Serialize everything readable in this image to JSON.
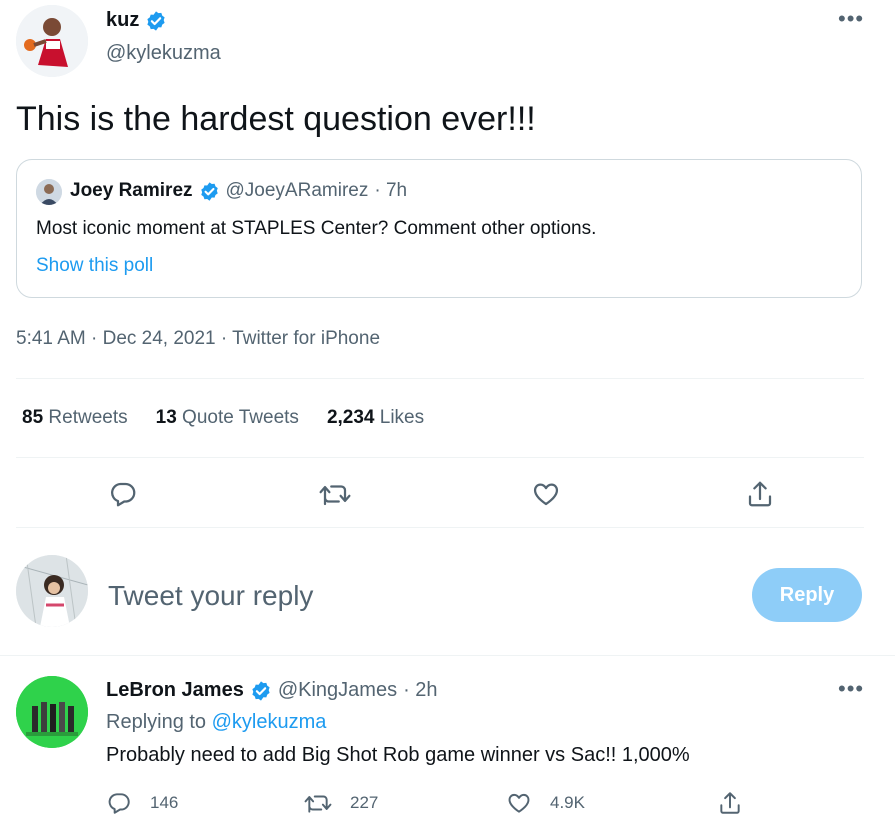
{
  "tweet": {
    "author_name": "kuz",
    "author_handle": "@kylekuzma",
    "text": "This is the hardest question ever!!!",
    "more_label": "•••",
    "timestamp": "5:41 AM · Dec 24, 2021 · Twitter for iPhone",
    "stats": {
      "retweets_count": "85",
      "retweets_label": "Retweets",
      "quotes_count": "13",
      "quotes_label": "Quote Tweets",
      "likes_count": "2,234",
      "likes_label": "Likes"
    }
  },
  "quoted": {
    "author_name": "Joey Ramirez",
    "author_handle": "@JoeyARamirez",
    "age": "· 7h",
    "text": "Most iconic moment at STAPLES Center? Comment other options.",
    "poll_link": "Show this poll"
  },
  "reply_box": {
    "placeholder": "Tweet your reply",
    "button_label": "Reply"
  },
  "reply": {
    "author_name": "LeBron James",
    "author_handle": "@KingJames",
    "age": "· 2h",
    "replying_prefix": "Replying to",
    "replying_to": "@kylekuzma",
    "text": "Probably need to add Big Shot Rob game winner vs Sac!! 1,000%",
    "more_label": "•••",
    "reply_count": "146",
    "retweet_count": "227",
    "like_count": "4.9K"
  },
  "colors": {
    "accent": "#1d9bf0",
    "muted": "#536471",
    "reply_button_disabled": "#8ecdf8"
  }
}
